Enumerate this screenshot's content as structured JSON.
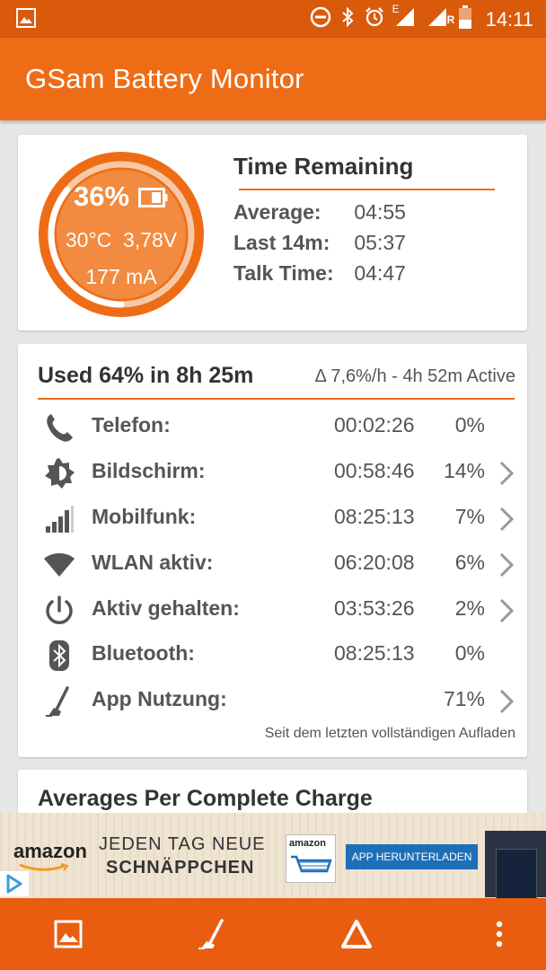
{
  "status_bar": {
    "time": "14:11",
    "network_label_1": "E",
    "network_label_2": "R"
  },
  "app": {
    "title": "GSam Battery Monitor"
  },
  "battery": {
    "percent_text": "36%",
    "level": 0.36,
    "temperature": "30°C",
    "voltage": "3,78V",
    "current": "177 mA"
  },
  "time_remaining": {
    "title": "Time Remaining",
    "rows": [
      {
        "label": "Average:",
        "value": "04:55"
      },
      {
        "label": "Last 14m:",
        "value": "05:37"
      },
      {
        "label": "Talk Time:",
        "value": "04:47"
      }
    ]
  },
  "usage": {
    "title": "Used 64% in 8h 25m",
    "subtitle": "Δ 7,6%/h - 4h 52m Active",
    "rows": [
      {
        "icon": "phone-icon",
        "name": "Telefon:",
        "time": "00:02:26",
        "percent": "0%",
        "has_detail": false
      },
      {
        "icon": "brightness-icon",
        "name": "Bildschirm:",
        "time": "00:58:46",
        "percent": "14%",
        "has_detail": true
      },
      {
        "icon": "signal-bars-icon",
        "name": "Mobilfunk:",
        "time": "08:25:13",
        "percent": "7%",
        "has_detail": true
      },
      {
        "icon": "wifi-icon",
        "name": "WLAN aktiv:",
        "time": "06:20:08",
        "percent": "6%",
        "has_detail": true
      },
      {
        "icon": "power-icon",
        "name": "Aktiv gehalten:",
        "time": "03:53:26",
        "percent": "2%",
        "has_detail": true
      },
      {
        "icon": "bluetooth-icon",
        "name": "Bluetooth:",
        "time": "08:25:13",
        "percent": "0%",
        "has_detail": false
      },
      {
        "icon": "app-usage-icon",
        "name": "App Nutzung:",
        "time": "",
        "percent": "71%",
        "has_detail": true
      }
    ],
    "footer": "Seit dem letzten vollständigen Aufladen"
  },
  "averages": {
    "title": "Averages Per Complete Charge"
  },
  "ad": {
    "brand": "amazon",
    "line1": "JEDEN TAG NEUE",
    "line2": "SCHNÄPPCHEN",
    "box_brand": "amazon",
    "button": "APP HERUNTERLADEN"
  },
  "bottom_nav": [
    {
      "icon": "picture-icon"
    },
    {
      "icon": "app-usage-icon"
    },
    {
      "icon": "delta-icon"
    },
    {
      "icon": "more-vert-icon"
    }
  ],
  "colors": {
    "status_bar": "#d95a0b",
    "app_bar": "#ef6c16",
    "accent": "#ef6c16",
    "bottom_nav": "#e85d0f"
  }
}
